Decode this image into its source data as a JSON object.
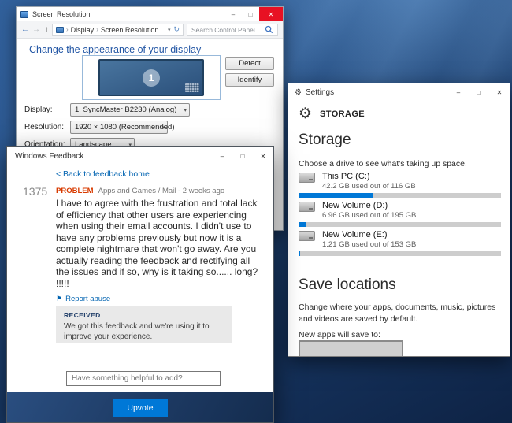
{
  "icons": {
    "minimize": "–",
    "maximize": "□",
    "close": "✕",
    "back": "←",
    "forward": "→",
    "up": "↑",
    "chevron_down": "▾",
    "refresh": "↻",
    "crumb_sep": "›",
    "flag": "⚑",
    "gear": "⚙"
  },
  "colors": {
    "accent": "#0078d7",
    "close_red": "#e81123",
    "problem_tag": "#d83b01",
    "link_blue": "#0063b1"
  },
  "screen_resolution": {
    "title": "Screen Resolution",
    "breadcrumb": [
      "Display",
      "Screen Resolution"
    ],
    "search_placeholder": "Search Control Panel",
    "heading": "Change the appearance of your display",
    "monitor_number": "1",
    "detect_label": "Detect",
    "identify_label": "Identify",
    "fields": [
      {
        "label": "Display:",
        "value": "1. SyncMaster B2230 (Analog)"
      },
      {
        "label": "Resolution:",
        "value": "1920 × 1080 (Recommended)"
      },
      {
        "label": "Orientation:",
        "value": "Landscape"
      }
    ]
  },
  "feedback": {
    "title": "Windows Feedback",
    "back_link": "< Back to feedback home",
    "vote_count": "1375",
    "tag": "PROBLEM",
    "meta": "Apps and Games / Mail - 2 weeks ago",
    "body": "I have to agree with the frustration and total lack of efficiency that other users are experiencing when using their email accounts. I didn't use to have any problems previously but now it is a complete nightmare that won't go away. Are you actually reading the feedback and rectifying all the issues and if so, why is it taking so...... long? !!!!!",
    "report_abuse": "Report abuse",
    "received_label": "RECEIVED",
    "received_text": "We got this feedback and we're using it to improve your experience.",
    "comment_placeholder": "Have something helpful to add?",
    "upvote_label": "Upvote"
  },
  "settings": {
    "title": "Settings",
    "page_header": "STORAGE",
    "storage_heading": "Storage",
    "storage_caption": "Choose a drive to see what's taking up space.",
    "drives": [
      {
        "name": "This PC (C:)",
        "usage": "42.2 GB used out of 116 GB",
        "percent": 36.4
      },
      {
        "name": "New Volume (D:)",
        "usage": "6.96 GB used out of 195 GB",
        "percent": 3.6
      },
      {
        "name": "New Volume (E:)",
        "usage": "1.21 GB used out of 153 GB",
        "percent": 0.8
      }
    ],
    "save_heading": "Save locations",
    "save_caption": "Change where your apps, documents, music, pictures and videos are saved by default.",
    "new_apps_label": "New apps will save to:"
  }
}
